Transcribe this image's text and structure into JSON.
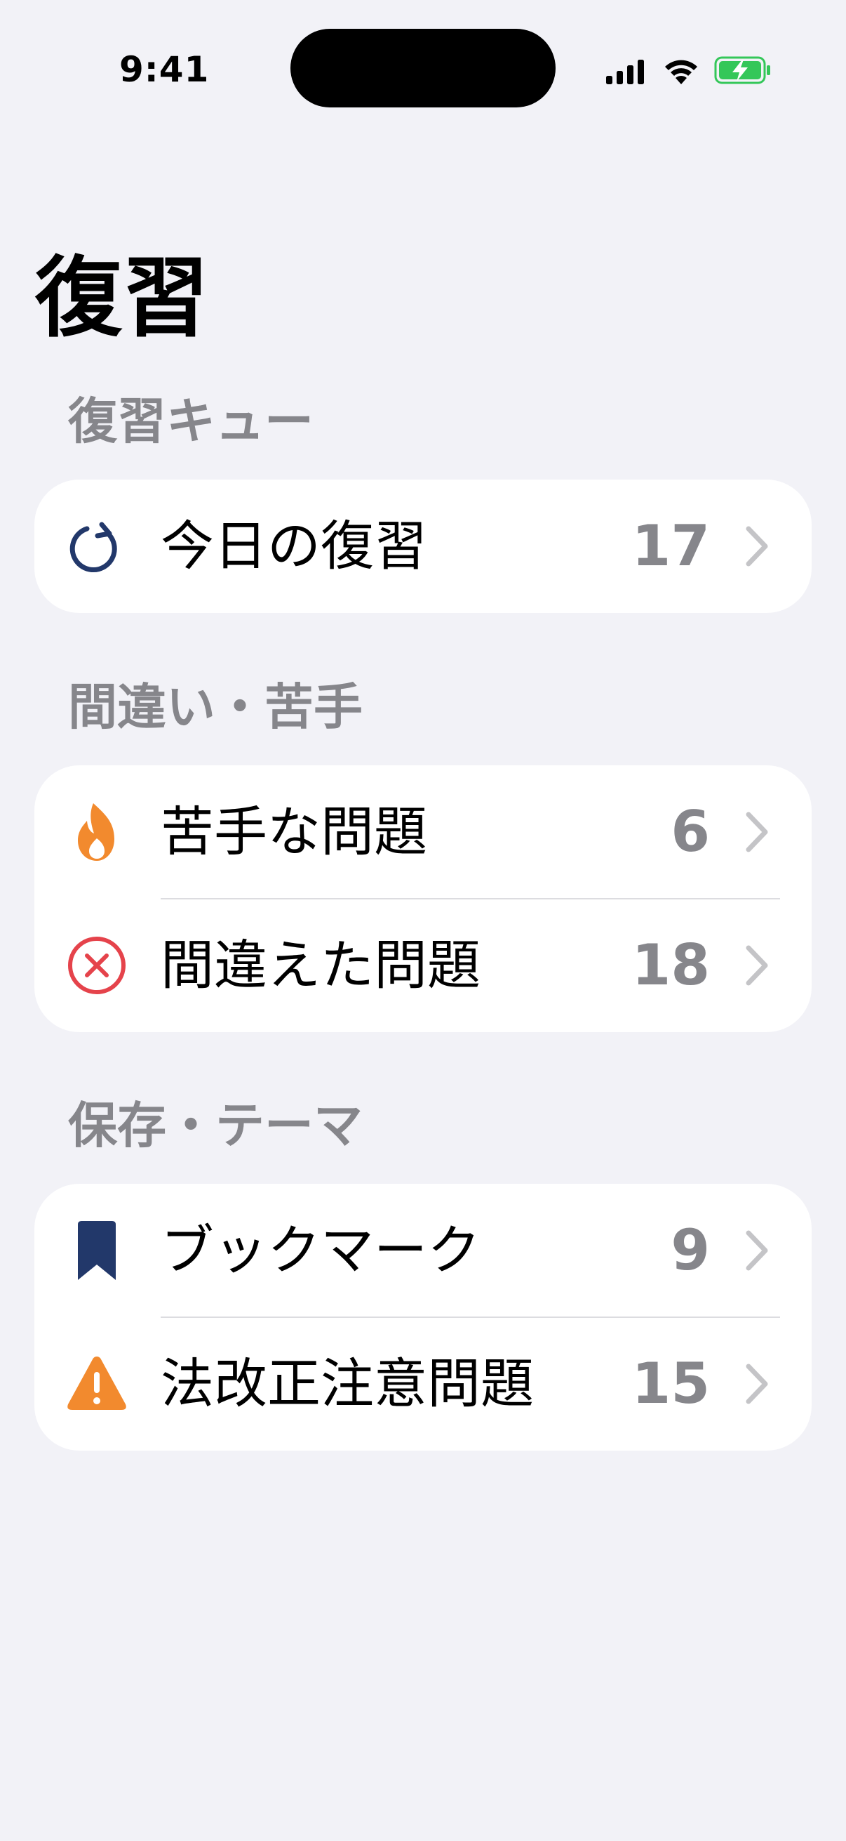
{
  "status_bar": {
    "time": "9:41",
    "signal_icon": "cellular-signal-icon",
    "wifi_icon": "wifi-icon",
    "battery_icon": "battery-charging-icon"
  },
  "page": {
    "title": "復習"
  },
  "sections": [
    {
      "header": "復習キュー",
      "rows": [
        {
          "label": "今日の復習",
          "count": "17",
          "icon": "refresh-icon",
          "icon_color": "#22386A"
        }
      ]
    },
    {
      "header": "間違い・苦手",
      "rows": [
        {
          "label": "苦手な問題",
          "count": "6",
          "icon": "flame-icon",
          "icon_color": "#F28A2E"
        },
        {
          "label": "間違えた問題",
          "count": "18",
          "icon": "x-circle-icon",
          "icon_color": "#E5434B"
        }
      ]
    },
    {
      "header": "保存・テーマ",
      "rows": [
        {
          "label": "ブックマーク",
          "count": "9",
          "icon": "bookmark-icon",
          "icon_color": "#22386A"
        },
        {
          "label": "法改正注意問題",
          "count": "15",
          "icon": "warning-icon",
          "icon_color": "#F28A2E"
        }
      ]
    }
  ],
  "colors": {
    "background": "#F2F2F7",
    "card": "#FFFFFF",
    "secondary_text": "#86868B",
    "chevron": "#C4C4C7",
    "battery": "#34C759"
  }
}
